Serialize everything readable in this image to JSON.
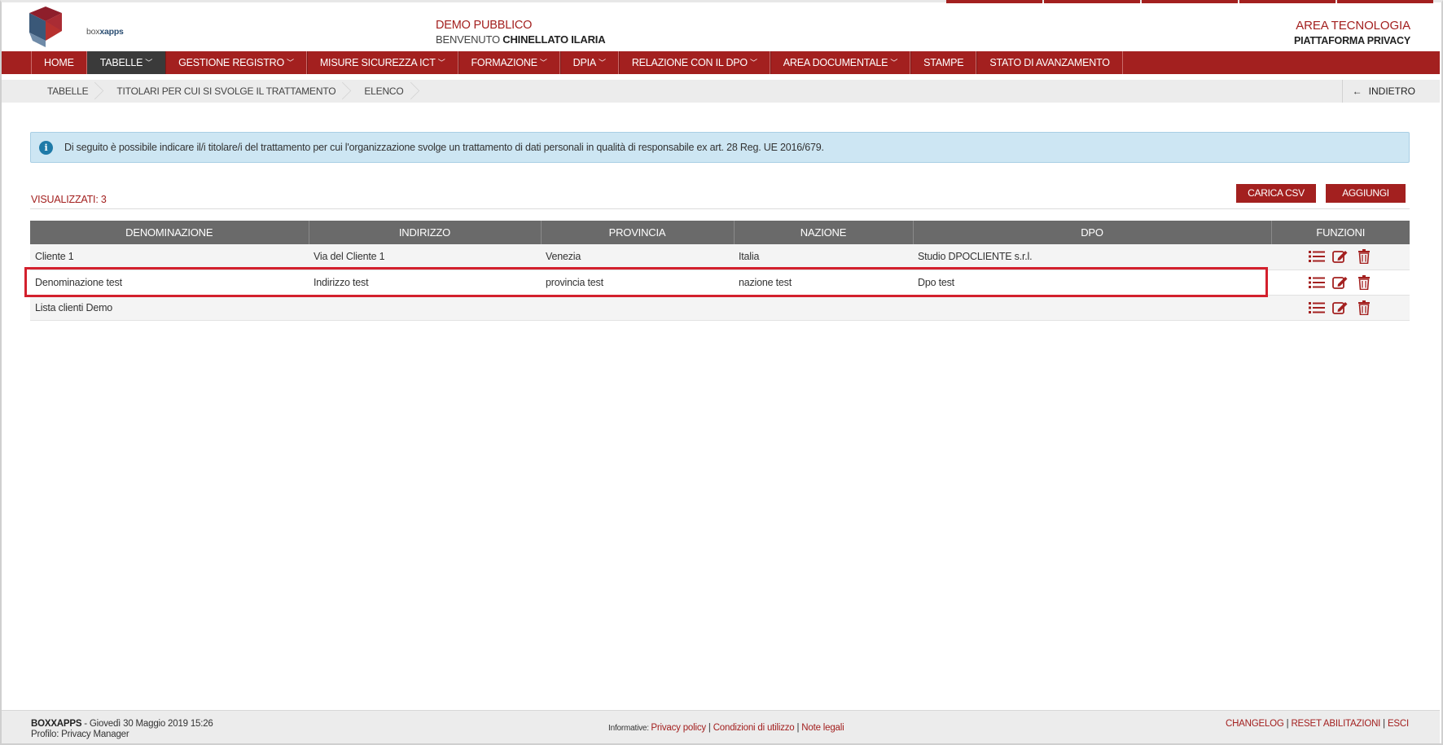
{
  "header": {
    "logo_text_prefix": "box",
    "logo_text_brand": "xapps",
    "title": "DEMO PUBBLICO",
    "welcome_prefix": "BENVENUTO ",
    "user_name": "CHINELLATO ILARIA",
    "area": "AREA TECNOLOGIA",
    "platform": "PIATTAFORMA PRIVACY"
  },
  "nav": {
    "items": [
      {
        "label": "HOME"
      },
      {
        "label": "TABELLE"
      },
      {
        "label": "GESTIONE REGISTRO"
      },
      {
        "label": "MISURE SICUREZZA ICT"
      },
      {
        "label": "FORMAZIONE"
      },
      {
        "label": "DPIA"
      },
      {
        "label": "RELAZIONE CON IL DPO"
      },
      {
        "label": "AREA DOCUMENTALE"
      },
      {
        "label": "STAMPE"
      },
      {
        "label": "STATO DI AVANZAMENTO"
      }
    ]
  },
  "breadcrumb": {
    "items": [
      "TABELLE",
      "TITOLARI PER CUI SI SVOLGE IL TRATTAMENTO",
      "ELENCO"
    ],
    "back_label": "INDIETRO"
  },
  "info": {
    "text": "Di seguito è possibile indicare il/i titolare/i del trattamento per cui l'organizzazione svolge un trattamento di dati personali in qualità di responsabile ex art. 28 Reg. UE 2016/679."
  },
  "toolbar": {
    "count_label": "VISUALIZZATI: 3",
    "csv_label": "CARICA CSV",
    "add_label": "AGGIUNGI"
  },
  "table": {
    "headers": [
      "DENOMINAZIONE",
      "INDIRIZZO",
      "PROVINCIA",
      "NAZIONE",
      "DPO",
      "FUNZIONI"
    ],
    "rows": [
      {
        "denominazione": "Cliente 1",
        "indirizzo": "Via del Cliente 1",
        "provincia": "Venezia",
        "nazione": "Italia",
        "dpo": "Studio DPOCLIENTE s.r.l."
      },
      {
        "denominazione": "Denominazione test",
        "indirizzo": "Indirizzo test",
        "provincia": "provincia test",
        "nazione": "nazione test",
        "dpo": "Dpo test"
      },
      {
        "denominazione": "Lista clienti Demo",
        "indirizzo": "",
        "provincia": "",
        "nazione": "",
        "dpo": ""
      }
    ]
  },
  "footer": {
    "brand": "BOXXAPPS",
    "date": " - Giovedì 30 Maggio 2019 15:26",
    "profile": "Profilo: Privacy Manager",
    "informative_label": "Informative: ",
    "privacy_policy": "Privacy policy",
    "conditions": "Condizioni di utilizzo",
    "legal_notes": "Note legali",
    "changelog": "CHANGELOG",
    "reset": "RESET ABILITAZIONI",
    "exit": "ESCI"
  },
  "colors": {
    "brand_red": "#a3201f",
    "nav_active": "#3a3a3a",
    "table_header": "#6a6a6a",
    "info_bg": "#cde6f3",
    "highlight": "#d3202d"
  },
  "icons": [
    "list-icon",
    "edit-icon",
    "trash-icon",
    "info-icon",
    "arrow-left-icon",
    "chevron-down-icon"
  ]
}
